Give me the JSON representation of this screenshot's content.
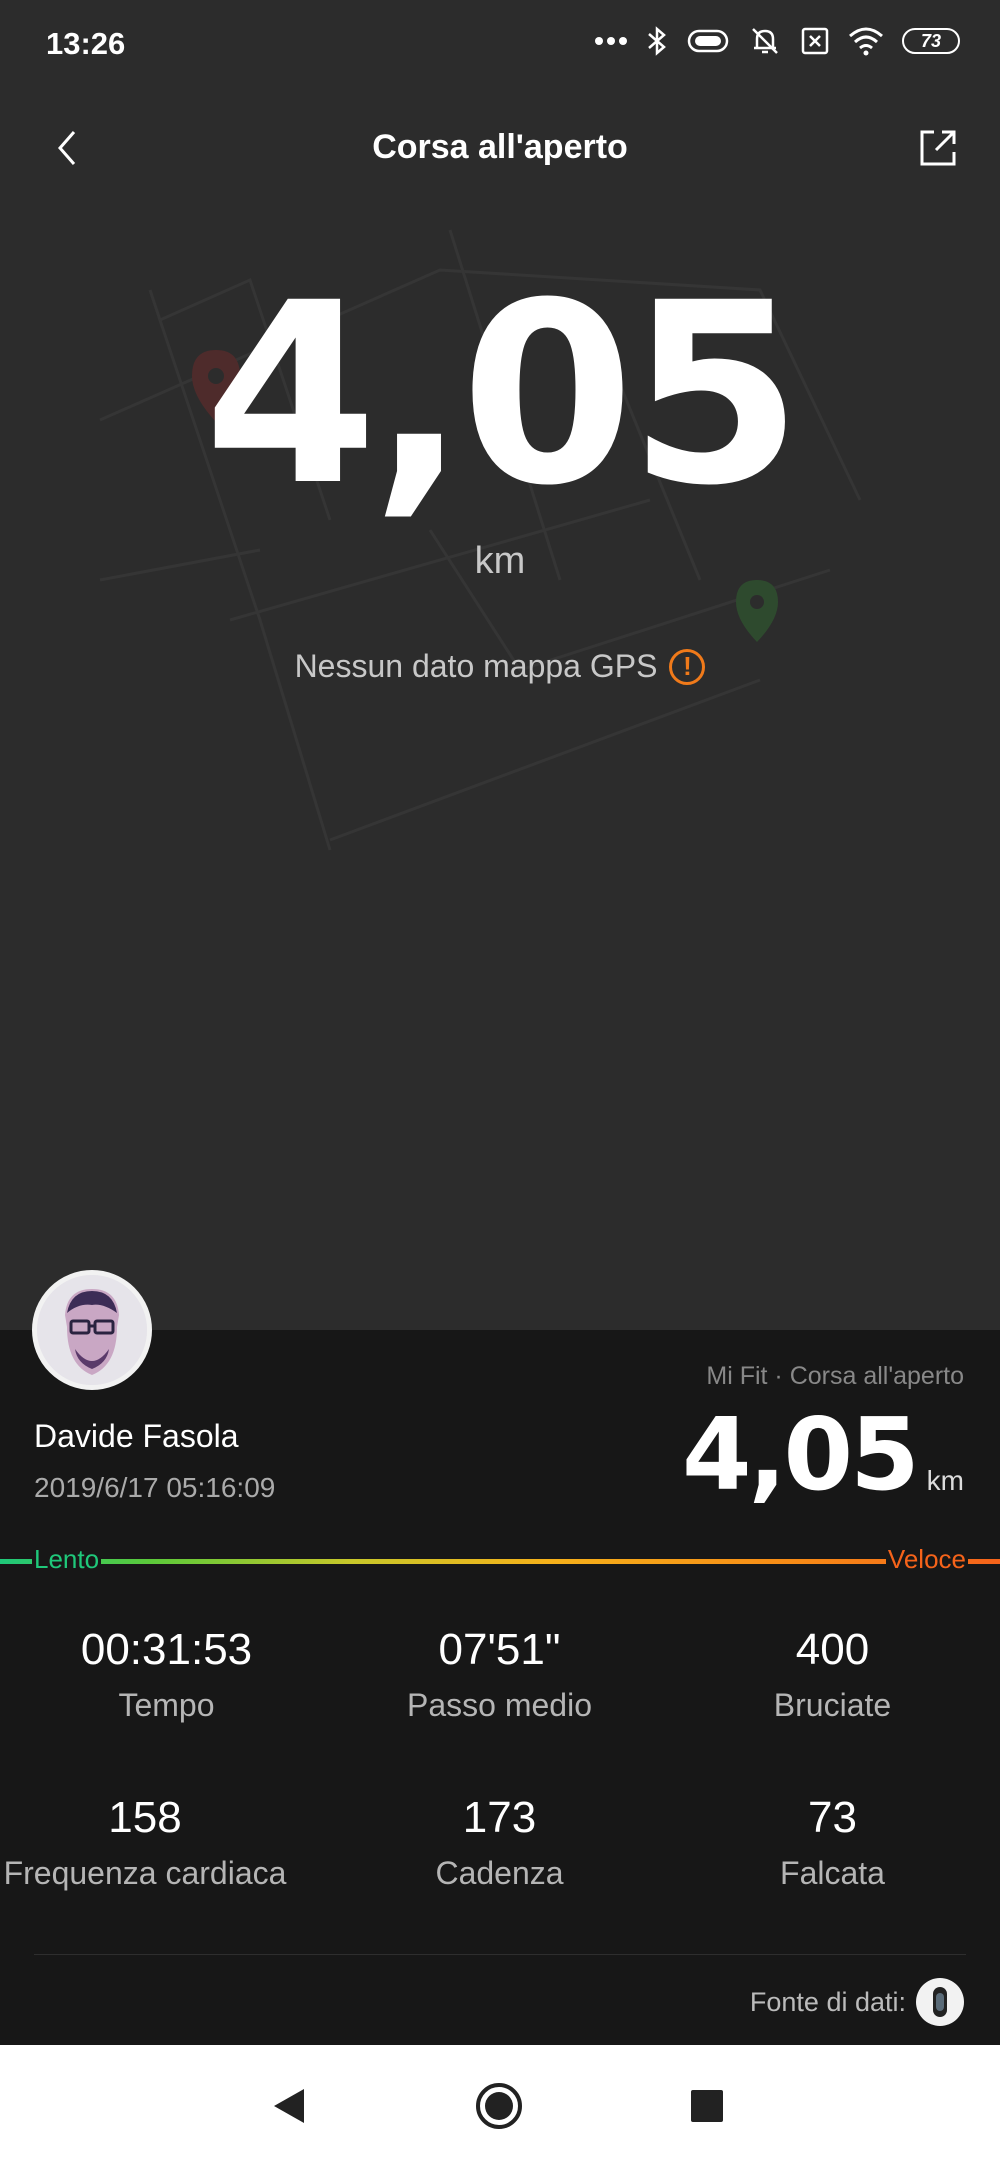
{
  "status_bar": {
    "time": "13:26",
    "battery": "73"
  },
  "header": {
    "title": "Corsa all'aperto"
  },
  "hero": {
    "distance": "4,05",
    "unit": "km",
    "gps_notice": "Nessun dato mappa GPS"
  },
  "summary": {
    "source": "Mi Fit · Corsa all'aperto",
    "user_name": "Davide Fasola",
    "date": "2019/6/17 05:16:09",
    "distance": "4,05",
    "unit": "km",
    "speed_slow": "Lento",
    "speed_fast": "Veloce",
    "stats": [
      {
        "value": "00:31:53",
        "label": "Tempo"
      },
      {
        "value": "07'51\"",
        "label": "Passo medio"
      },
      {
        "value": "400",
        "label": "Bruciate"
      },
      {
        "value": "158",
        "label": "Frequenza cardiaca"
      },
      {
        "value": "173",
        "label": "Cadenza"
      },
      {
        "value": "73",
        "label": "Falcata"
      }
    ],
    "data_source_label": "Fonte di dati:"
  },
  "colors": {
    "accent_warning": "#f07a1a",
    "speed_slow": "#1fc87a",
    "speed_fast": "#f5631a"
  }
}
